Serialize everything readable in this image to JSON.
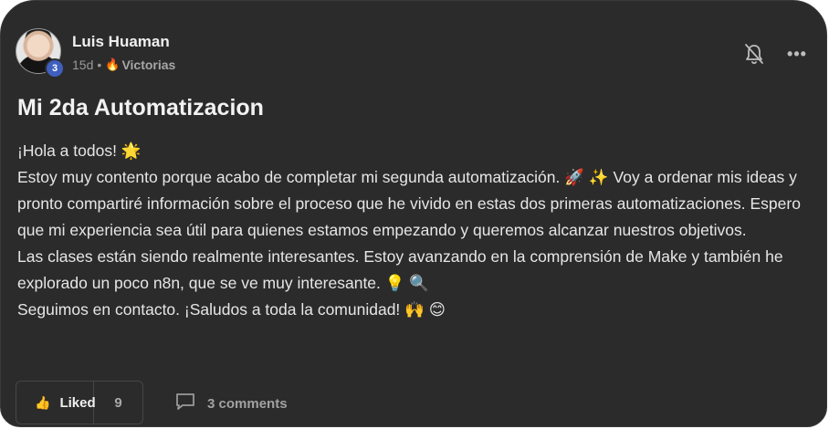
{
  "post": {
    "author": {
      "name": "Luis Huaman",
      "level": "3"
    },
    "time": "15d",
    "separator": "•",
    "category": "Victorias",
    "category_icon": "🔥",
    "title": "Mi 2da Automatizacion",
    "paragraphs": [
      "¡Hola a todos! 🌟",
      "Estoy muy contento porque acabo de completar mi segunda automatización. 🚀 ✨ Voy a ordenar mis ideas y pronto compartiré información sobre el proceso que he vivido en estas dos primeras automatizaciones. Espero que mi experiencia sea útil para quienes estamos empezando y queremos alcanzar nuestros objetivos.",
      "Las clases están siendo realmente interesantes. Estoy avanzando en la comprensión de Make y también he explorado un poco n8n, que se ve muy interesante. 💡 🔍",
      "Seguimos en contacto. ¡Saludos a toda la comunidad! 🙌 😊"
    ]
  },
  "actions": {
    "like_label": "Liked",
    "like_count": "9",
    "comments_label": "3 comments"
  },
  "icons": {
    "bell": "bell-off-icon",
    "more": "more-horizontal-icon",
    "thumb": "thumbs-up-icon",
    "comment": "comment-icon",
    "more_glyph": "•••",
    "thumb_glyph": "👍"
  },
  "colors": {
    "card_bg": "#2b2b2b",
    "badge_bg": "#3f5fbf",
    "text": "#e6e6e6",
    "muted": "#9a9a9a"
  }
}
